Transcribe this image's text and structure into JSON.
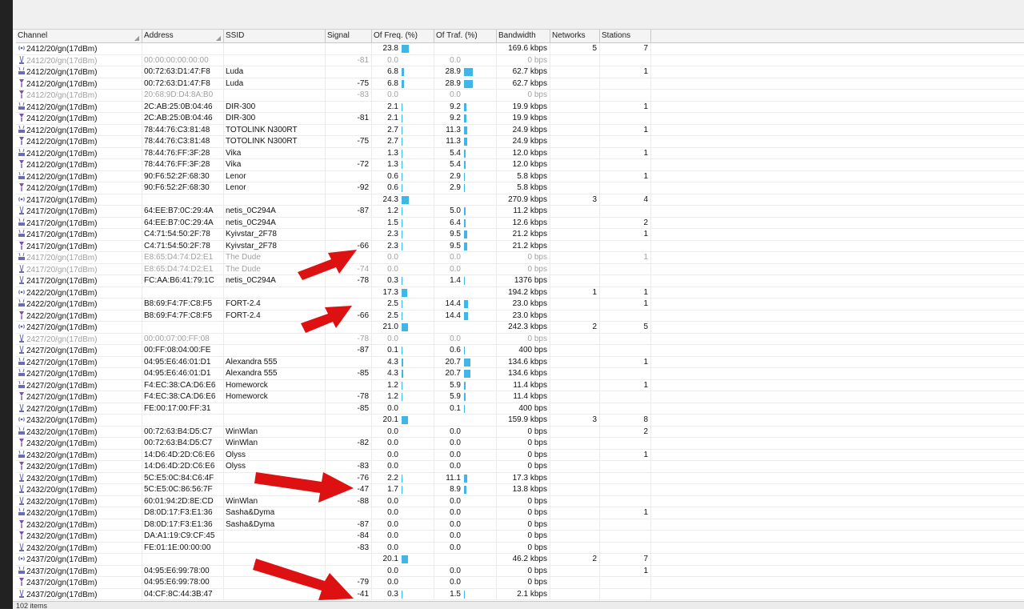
{
  "colors": {
    "bar": "#3fb6e6",
    "arrow": "#dd1111"
  },
  "columns": {
    "channel": "Channel",
    "address": "Address",
    "ssid": "SSID",
    "signal": "Signal",
    "freq": "Of Freq. (%)",
    "traf": "Of Traf. (%)",
    "bandwidth": "Bandwidth",
    "networks": "Networks",
    "stations": "Stations"
  },
  "status": {
    "items_label": "102 items"
  },
  "rows": [
    {
      "icon": "channel-icon",
      "channel": "2412/20/gn(17dBm)",
      "address": "",
      "ssid": "",
      "signal": "",
      "freq": "23.8",
      "traf": "",
      "bandwidth": "169.6 kbps",
      "networks": "5",
      "stations": "7",
      "dim": false
    },
    {
      "icon": "station-icon",
      "channel": "2412/20/gn(17dBm)",
      "address": "00:00:00:00:00:00",
      "ssid": "",
      "signal": "-81",
      "freq": "0.0",
      "traf": "0.0",
      "bandwidth": "0 bps",
      "networks": "",
      "stations": "",
      "dim": true
    },
    {
      "icon": "ap-icon",
      "channel": "2412/20/gn(17dBm)",
      "address": "00:72:63:D1:47:F8",
      "ssid": "Luda",
      "signal": "",
      "freq": "6.8",
      "traf": "28.9",
      "bandwidth": "62.7 kbps",
      "networks": "",
      "stations": "1",
      "dim": false
    },
    {
      "icon": "client-icon",
      "channel": "2412/20/gn(17dBm)",
      "address": "00:72:63:D1:47:F8",
      "ssid": "Luda",
      "signal": "-75",
      "freq": "6.8",
      "traf": "28.9",
      "bandwidth": "62.7 kbps",
      "networks": "",
      "stations": "",
      "dim": false
    },
    {
      "icon": "client-icon",
      "channel": "2412/20/gn(17dBm)",
      "address": "20:68:9D:D4:8A:B0",
      "ssid": "",
      "signal": "-83",
      "freq": "0.0",
      "traf": "0.0",
      "bandwidth": "0 bps",
      "networks": "",
      "stations": "",
      "dim": true
    },
    {
      "icon": "ap-icon",
      "channel": "2412/20/gn(17dBm)",
      "address": "2C:AB:25:0B:04:46",
      "ssid": "DIR-300",
      "signal": "",
      "freq": "2.1",
      "traf": "9.2",
      "bandwidth": "19.9 kbps",
      "networks": "",
      "stations": "1",
      "dim": false
    },
    {
      "icon": "client-icon",
      "channel": "2412/20/gn(17dBm)",
      "address": "2C:AB:25:0B:04:46",
      "ssid": "DIR-300",
      "signal": "-81",
      "freq": "2.1",
      "traf": "9.2",
      "bandwidth": "19.9 kbps",
      "networks": "",
      "stations": "",
      "dim": false
    },
    {
      "icon": "ap-icon",
      "channel": "2412/20/gn(17dBm)",
      "address": "78:44:76:C3:81:48",
      "ssid": "TOTOLINK N300RT",
      "signal": "",
      "freq": "2.7",
      "traf": "11.3",
      "bandwidth": "24.9 kbps",
      "networks": "",
      "stations": "1",
      "dim": false
    },
    {
      "icon": "client-icon",
      "channel": "2412/20/gn(17dBm)",
      "address": "78:44:76:C3:81:48",
      "ssid": "TOTOLINK N300RT",
      "signal": "-75",
      "freq": "2.7",
      "traf": "11.3",
      "bandwidth": "24.9 kbps",
      "networks": "",
      "stations": "",
      "dim": false
    },
    {
      "icon": "ap-icon",
      "channel": "2412/20/gn(17dBm)",
      "address": "78:44:76:FF:3F:28",
      "ssid": "Vika",
      "signal": "",
      "freq": "1.3",
      "traf": "5.4",
      "bandwidth": "12.0 kbps",
      "networks": "",
      "stations": "1",
      "dim": false
    },
    {
      "icon": "client-icon",
      "channel": "2412/20/gn(17dBm)",
      "address": "78:44:76:FF:3F:28",
      "ssid": "Vika",
      "signal": "-72",
      "freq": "1.3",
      "traf": "5.4",
      "bandwidth": "12.0 kbps",
      "networks": "",
      "stations": "",
      "dim": false
    },
    {
      "icon": "ap-icon",
      "channel": "2412/20/gn(17dBm)",
      "address": "90:F6:52:2F:68:30",
      "ssid": "Lenor",
      "signal": "",
      "freq": "0.6",
      "traf": "2.9",
      "bandwidth": "5.8 kbps",
      "networks": "",
      "stations": "1",
      "dim": false
    },
    {
      "icon": "client-icon",
      "channel": "2412/20/gn(17dBm)",
      "address": "90:F6:52:2F:68:30",
      "ssid": "Lenor",
      "signal": "-92",
      "freq": "0.6",
      "traf": "2.9",
      "bandwidth": "5.8 kbps",
      "networks": "",
      "stations": "",
      "dim": false
    },
    {
      "icon": "channel-icon",
      "channel": "2417/20/gn(17dBm)",
      "address": "",
      "ssid": "",
      "signal": "",
      "freq": "24.3",
      "traf": "",
      "bandwidth": "270.9 kbps",
      "networks": "3",
      "stations": "4",
      "dim": false
    },
    {
      "icon": "station-icon",
      "channel": "2417/20/gn(17dBm)",
      "address": "64:EE:B7:0C:29:4A",
      "ssid": "netis_0C294A",
      "signal": "-87",
      "freq": "1.2",
      "traf": "5.0",
      "bandwidth": "11.2 kbps",
      "networks": "",
      "stations": "",
      "dim": false
    },
    {
      "icon": "ap-icon",
      "channel": "2417/20/gn(17dBm)",
      "address": "64:EE:B7:0C:29:4A",
      "ssid": "netis_0C294A",
      "signal": "",
      "freq": "1.5",
      "traf": "6.4",
      "bandwidth": "12.6 kbps",
      "networks": "",
      "stations": "2",
      "dim": false
    },
    {
      "icon": "ap-icon",
      "channel": "2417/20/gn(17dBm)",
      "address": "C4:71:54:50:2F:78",
      "ssid": "Kyivstar_2F78",
      "signal": "",
      "freq": "2.3",
      "traf": "9.5",
      "bandwidth": "21.2 kbps",
      "networks": "",
      "stations": "1",
      "dim": false
    },
    {
      "icon": "client-icon",
      "channel": "2417/20/gn(17dBm)",
      "address": "C4:71:54:50:2F:78",
      "ssid": "Kyivstar_2F78",
      "signal": "-66",
      "freq": "2.3",
      "traf": "9.5",
      "bandwidth": "21.2 kbps",
      "networks": "",
      "stations": "",
      "dim": false
    },
    {
      "icon": "ap-icon",
      "channel": "2417/20/gn(17dBm)",
      "address": "E8:65:D4:74:D2:E1",
      "ssid": "The Dude",
      "signal": "",
      "freq": "0.0",
      "traf": "0.0",
      "bandwidth": "0 bps",
      "networks": "",
      "stations": "1",
      "dim": true
    },
    {
      "icon": "station-icon",
      "channel": "2417/20/gn(17dBm)",
      "address": "E8:65:D4:74:D2:E1",
      "ssid": "The Dude",
      "signal": "-74",
      "freq": "0.0",
      "traf": "0.0",
      "bandwidth": "0 bps",
      "networks": "",
      "stations": "",
      "dim": true
    },
    {
      "icon": "station-icon",
      "channel": "2417/20/gn(17dBm)",
      "address": "FC:AA:B6:41:79:1C",
      "ssid": "netis_0C294A",
      "signal": "-78",
      "freq": "0.3",
      "traf": "1.4",
      "bandwidth": "1376 bps",
      "networks": "",
      "stations": "",
      "dim": false
    },
    {
      "icon": "channel-icon",
      "channel": "2422/20/gn(17dBm)",
      "address": "",
      "ssid": "",
      "signal": "",
      "freq": "17.3",
      "traf": "",
      "bandwidth": "194.2 kbps",
      "networks": "1",
      "stations": "1",
      "dim": false
    },
    {
      "icon": "ap-icon",
      "channel": "2422/20/gn(17dBm)",
      "address": "B8:69:F4:7F:C8:F5",
      "ssid": "FORT-2.4",
      "signal": "",
      "freq": "2.5",
      "traf": "14.4",
      "bandwidth": "23.0 kbps",
      "networks": "",
      "stations": "1",
      "dim": false
    },
    {
      "icon": "client-icon",
      "channel": "2422/20/gn(17dBm)",
      "address": "B8:69:F4:7F:C8:F5",
      "ssid": "FORT-2.4",
      "signal": "-66",
      "freq": "2.5",
      "traf": "14.4",
      "bandwidth": "23.0 kbps",
      "networks": "",
      "stations": "",
      "dim": false
    },
    {
      "icon": "channel-icon",
      "channel": "2427/20/gn(17dBm)",
      "address": "",
      "ssid": "",
      "signal": "",
      "freq": "21.0",
      "traf": "",
      "bandwidth": "242.3 kbps",
      "networks": "2",
      "stations": "5",
      "dim": false
    },
    {
      "icon": "station-icon",
      "channel": "2427/20/gn(17dBm)",
      "address": "00:00:07:00:FF:08",
      "ssid": "",
      "signal": "-78",
      "freq": "0.0",
      "traf": "0.0",
      "bandwidth": "0 bps",
      "networks": "",
      "stations": "",
      "dim": true
    },
    {
      "icon": "station-icon",
      "channel": "2427/20/gn(17dBm)",
      "address": "00:FF:08:04:00:FE",
      "ssid": "",
      "signal": "-87",
      "freq": "0.1",
      "traf": "0.6",
      "bandwidth": "400 bps",
      "networks": "",
      "stations": "",
      "dim": false
    },
    {
      "icon": "ap-icon",
      "channel": "2427/20/gn(17dBm)",
      "address": "04:95:E6:46:01:D1",
      "ssid": "Alexandra 555",
      "signal": "",
      "freq": "4.3",
      "traf": "20.7",
      "bandwidth": "134.6 kbps",
      "networks": "",
      "stations": "1",
      "dim": false
    },
    {
      "icon": "ap-icon",
      "channel": "2427/20/gn(17dBm)",
      "address": "04:95:E6:46:01:D1",
      "ssid": "Alexandra 555",
      "signal": "-85",
      "freq": "4.3",
      "traf": "20.7",
      "bandwidth": "134.6 kbps",
      "networks": "",
      "stations": "",
      "dim": false
    },
    {
      "icon": "ap-icon",
      "channel": "2427/20/gn(17dBm)",
      "address": "F4:EC:38:CA:D6:E6",
      "ssid": "Homeworck",
      "signal": "",
      "freq": "1.2",
      "traf": "5.9",
      "bandwidth": "11.4 kbps",
      "networks": "",
      "stations": "1",
      "dim": false
    },
    {
      "icon": "client-icon",
      "channel": "2427/20/gn(17dBm)",
      "address": "F4:EC:38:CA:D6:E6",
      "ssid": "Homeworck",
      "signal": "-78",
      "freq": "1.2",
      "traf": "5.9",
      "bandwidth": "11.4 kbps",
      "networks": "",
      "stations": "",
      "dim": false
    },
    {
      "icon": "station-icon",
      "channel": "2427/20/gn(17dBm)",
      "address": "FE:00:17:00:FF:31",
      "ssid": "",
      "signal": "-85",
      "freq": "0.0",
      "traf": "0.1",
      "bandwidth": "400 bps",
      "networks": "",
      "stations": "",
      "dim": false
    },
    {
      "icon": "channel-icon",
      "channel": "2432/20/gn(17dBm)",
      "address": "",
      "ssid": "",
      "signal": "",
      "freq": "20.1",
      "traf": "",
      "bandwidth": "159.9 kbps",
      "networks": "3",
      "stations": "8",
      "dim": false
    },
    {
      "icon": "ap-icon",
      "channel": "2432/20/gn(17dBm)",
      "address": "00:72:63:B4:D5:C7",
      "ssid": "WinWlan",
      "signal": "",
      "freq": "0.0",
      "traf": "0.0",
      "bandwidth": "0 bps",
      "networks": "",
      "stations": "2",
      "dim": false
    },
    {
      "icon": "client-icon",
      "channel": "2432/20/gn(17dBm)",
      "address": "00:72:63:B4:D5:C7",
      "ssid": "WinWlan",
      "signal": "-82",
      "freq": "0.0",
      "traf": "0.0",
      "bandwidth": "0 bps",
      "networks": "",
      "stations": "",
      "dim": false
    },
    {
      "icon": "ap-icon",
      "channel": "2432/20/gn(17dBm)",
      "address": "14:D6:4D:2D:C6:E6",
      "ssid": "Olyss",
      "signal": "",
      "freq": "0.0",
      "traf": "0.0",
      "bandwidth": "0 bps",
      "networks": "",
      "stations": "1",
      "dim": false
    },
    {
      "icon": "client-icon",
      "channel": "2432/20/gn(17dBm)",
      "address": "14:D6:4D:2D:C6:E6",
      "ssid": "Olyss",
      "signal": "-83",
      "freq": "0.0",
      "traf": "0.0",
      "bandwidth": "0 bps",
      "networks": "",
      "stations": "",
      "dim": false
    },
    {
      "icon": "station-icon",
      "channel": "2432/20/gn(17dBm)",
      "address": "5C:E5:0C:84:C6:4F",
      "ssid": "",
      "signal": "-76",
      "freq": "2.2",
      "traf": "11.1",
      "bandwidth": "17.3 kbps",
      "networks": "",
      "stations": "",
      "dim": false
    },
    {
      "icon": "station-icon",
      "channel": "2432/20/gn(17dBm)",
      "address": "5C:E5:0C:86:56:7F",
      "ssid": "",
      "signal": "-47",
      "freq": "1.7",
      "traf": "8.9",
      "bandwidth": "13.8 kbps",
      "networks": "",
      "stations": "",
      "dim": false
    },
    {
      "icon": "station-icon",
      "channel": "2432/20/gn(17dBm)",
      "address": "60:01:94:2D:8E:CD",
      "ssid": "WinWlan",
      "signal": "-88",
      "freq": "0.0",
      "traf": "0.0",
      "bandwidth": "0 bps",
      "networks": "",
      "stations": "",
      "dim": false
    },
    {
      "icon": "ap-icon",
      "channel": "2432/20/gn(17dBm)",
      "address": "D8:0D:17:F3:E1:36",
      "ssid": "Sasha&Dyma",
      "signal": "",
      "freq": "0.0",
      "traf": "0.0",
      "bandwidth": "0 bps",
      "networks": "",
      "stations": "1",
      "dim": false
    },
    {
      "icon": "client-icon",
      "channel": "2432/20/gn(17dBm)",
      "address": "D8:0D:17:F3:E1:36",
      "ssid": "Sasha&Dyma",
      "signal": "-87",
      "freq": "0.0",
      "traf": "0.0",
      "bandwidth": "0 bps",
      "networks": "",
      "stations": "",
      "dim": false
    },
    {
      "icon": "client-icon",
      "channel": "2432/20/gn(17dBm)",
      "address": "DA:A1:19:C9:CF:45",
      "ssid": "",
      "signal": "-84",
      "freq": "0.0",
      "traf": "0.0",
      "bandwidth": "0 bps",
      "networks": "",
      "stations": "",
      "dim": false
    },
    {
      "icon": "station-icon",
      "channel": "2432/20/gn(17dBm)",
      "address": "FE:01:1E:00:00:00",
      "ssid": "",
      "signal": "-83",
      "freq": "0.0",
      "traf": "0.0",
      "bandwidth": "0 bps",
      "networks": "",
      "stations": "",
      "dim": false
    },
    {
      "icon": "channel-icon",
      "channel": "2437/20/gn(17dBm)",
      "address": "",
      "ssid": "",
      "signal": "",
      "freq": "20.1",
      "traf": "",
      "bandwidth": "46.2 kbps",
      "networks": "2",
      "stations": "7",
      "dim": false
    },
    {
      "icon": "ap-icon",
      "channel": "2437/20/gn(17dBm)",
      "address": "04:95:E6:99:78:00",
      "ssid": "",
      "signal": "",
      "freq": "0.0",
      "traf": "0.0",
      "bandwidth": "0 bps",
      "networks": "",
      "stations": "1",
      "dim": false
    },
    {
      "icon": "client-icon",
      "channel": "2437/20/gn(17dBm)",
      "address": "04:95:E6:99:78:00",
      "ssid": "",
      "signal": "-79",
      "freq": "0.0",
      "traf": "0.0",
      "bandwidth": "0 bps",
      "networks": "",
      "stations": "",
      "dim": false
    },
    {
      "icon": "station-icon",
      "channel": "2437/20/gn(17dBm)",
      "address": "04:CF:8C:44:3B:47",
      "ssid": "",
      "signal": "-41",
      "freq": "0.3",
      "traf": "1.5",
      "bandwidth": "2.1 kbps",
      "networks": "",
      "stations": "",
      "dim": false
    }
  ]
}
